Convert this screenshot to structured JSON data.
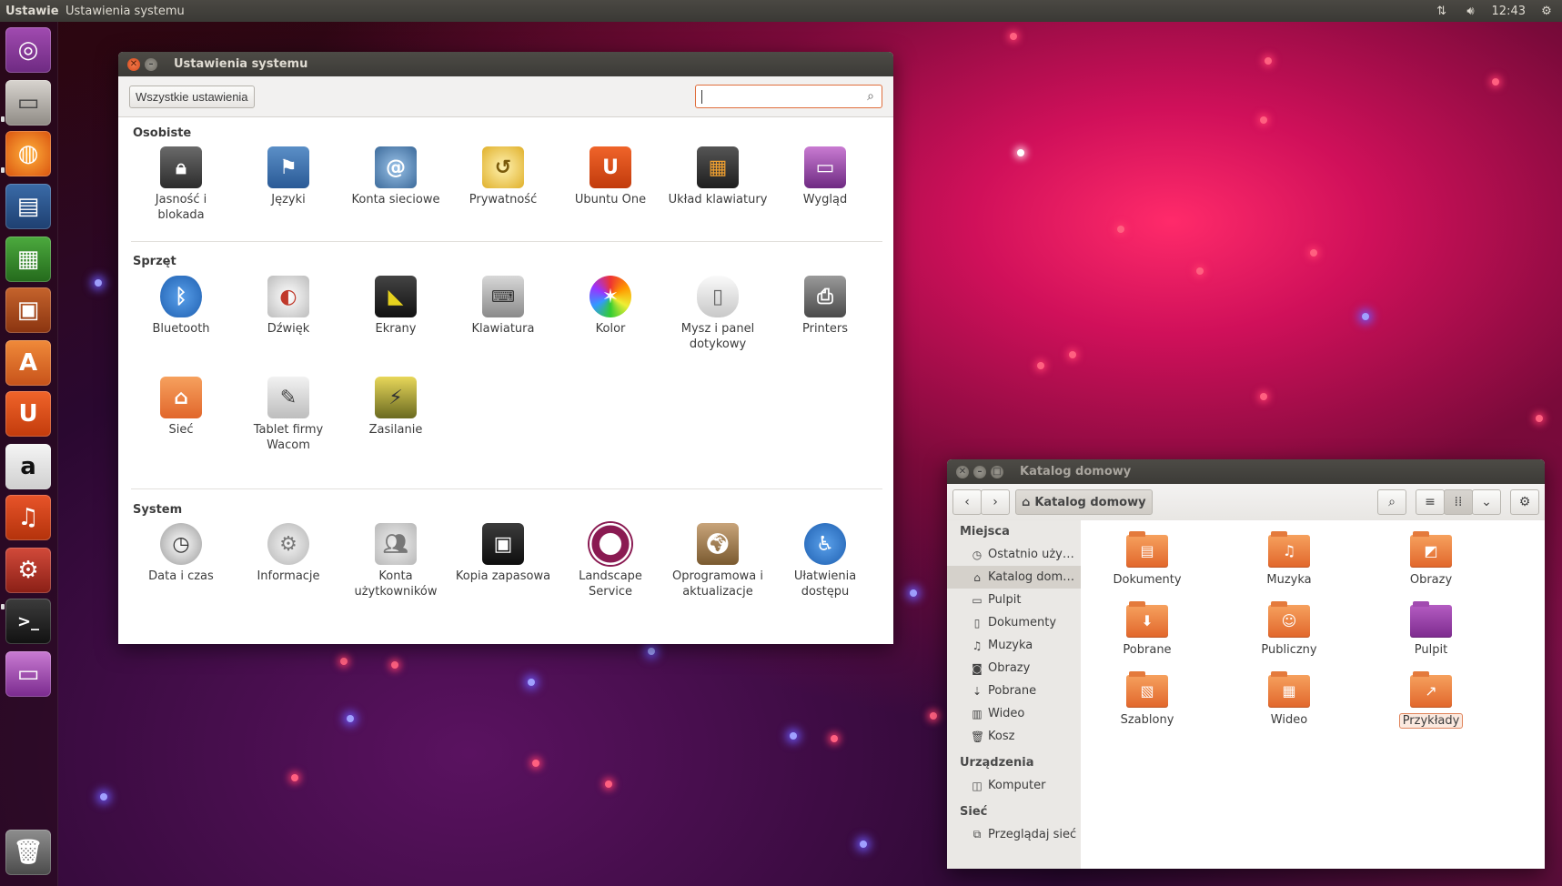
{
  "top_panel": {
    "app_name": "Ustawienia systemu",
    "window_title": "Ustawienia systemu",
    "clock": "12:43"
  },
  "launcher": {
    "items": [
      "ubuntu-dash",
      "files",
      "firefox",
      "libreoffice-writer",
      "libreoffice-calc",
      "libreoffice-impress",
      "ubuntu-software-center",
      "ubuntu-one",
      "amazon",
      "ubuntu-one-music",
      "system-settings",
      "terminal",
      "workspace-switcher",
      "trash"
    ]
  },
  "settings": {
    "title": "Ustawienia systemu",
    "all_settings_label": "Wszystkie ustawienia",
    "search_value": "",
    "sections": [
      {
        "title": "Osobiste",
        "items": [
          {
            "label": "Jasność i blokada",
            "icon": "lock-screen-icon"
          },
          {
            "label": "Języki",
            "icon": "flag-icon"
          },
          {
            "label": "Konta sieciowe",
            "icon": "online-accounts-icon"
          },
          {
            "label": "Prywatność",
            "icon": "privacy-icon"
          },
          {
            "label": "Ubuntu One",
            "icon": "ubuntu-one-icon"
          },
          {
            "label": "Układ klawiatury",
            "icon": "keyboard-layout-icon"
          },
          {
            "label": "Wygląd",
            "icon": "appearance-icon"
          }
        ]
      },
      {
        "title": "Sprzęt",
        "items": [
          {
            "label": "Bluetooth",
            "icon": "bluetooth-icon"
          },
          {
            "label": "Dźwięk",
            "icon": "sound-icon"
          },
          {
            "label": "Ekrany",
            "icon": "displays-icon"
          },
          {
            "label": "Klawiatura",
            "icon": "keyboard-icon"
          },
          {
            "label": "Kolor",
            "icon": "color-icon"
          },
          {
            "label": "Mysz i panel dotykowy",
            "icon": "mouse-icon"
          },
          {
            "label": "Printers",
            "icon": "printer-icon"
          },
          {
            "label": "Sieć",
            "icon": "network-icon"
          },
          {
            "label": "Tablet firmy Wacom",
            "icon": "wacom-tablet-icon"
          },
          {
            "label": "Zasilanie",
            "icon": "power-icon"
          }
        ]
      },
      {
        "title": "System",
        "items": [
          {
            "label": "Data i czas",
            "icon": "clock-icon"
          },
          {
            "label": "Informacje",
            "icon": "gear-icon"
          },
          {
            "label": "Konta użytkowników",
            "icon": "users-icon"
          },
          {
            "label": "Kopia zapasowa",
            "icon": "backup-icon"
          },
          {
            "label": "Landscape Service",
            "icon": "landscape-icon"
          },
          {
            "label": "Oprogramowa i aktualizacje",
            "icon": "software-updates-icon"
          },
          {
            "label": "Ułatwienia dostępu",
            "icon": "accessibility-icon"
          }
        ]
      }
    ]
  },
  "files": {
    "title": "Katalog domowy",
    "crumb": "Katalog domowy",
    "sidebar": {
      "places_header": "Miejsca",
      "places": [
        {
          "label": "Ostatnio uży…",
          "icon": "recent-icon"
        },
        {
          "label": "Katalog dom…",
          "icon": "home-icon",
          "active": true
        },
        {
          "label": "Pulpit",
          "icon": "desktop-icon"
        },
        {
          "label": "Dokumenty",
          "icon": "documents-icon"
        },
        {
          "label": "Muzyka",
          "icon": "music-icon"
        },
        {
          "label": "Obrazy",
          "icon": "pictures-icon"
        },
        {
          "label": "Pobrane",
          "icon": "downloads-icon"
        },
        {
          "label": "Wideo",
          "icon": "videos-icon"
        },
        {
          "label": "Kosz",
          "icon": "trash-icon"
        }
      ],
      "devices_header": "Urządzenia",
      "devices": [
        {
          "label": "Komputer",
          "icon": "computer-icon"
        }
      ],
      "network_header": "Sieć",
      "network": [
        {
          "label": "Przeglądaj sieć",
          "icon": "network-browse-icon"
        }
      ]
    },
    "folders": [
      {
        "label": "Dokumenty",
        "glyph": "▤"
      },
      {
        "label": "Muzyka",
        "glyph": "♫"
      },
      {
        "label": "Obrazy",
        "glyph": "◩"
      },
      {
        "label": "Pobrane",
        "glyph": "⬇"
      },
      {
        "label": "Publiczny",
        "glyph": "☺"
      },
      {
        "label": "Pulpit",
        "glyph": ""
      },
      {
        "label": "Szablony",
        "glyph": "▧"
      },
      {
        "label": "Wideo",
        "glyph": "▦"
      },
      {
        "label": "Przykłady",
        "glyph": "↗",
        "selected": true
      }
    ]
  },
  "colors": {
    "accent": "#dd4814",
    "panel": "#3c3b37"
  }
}
